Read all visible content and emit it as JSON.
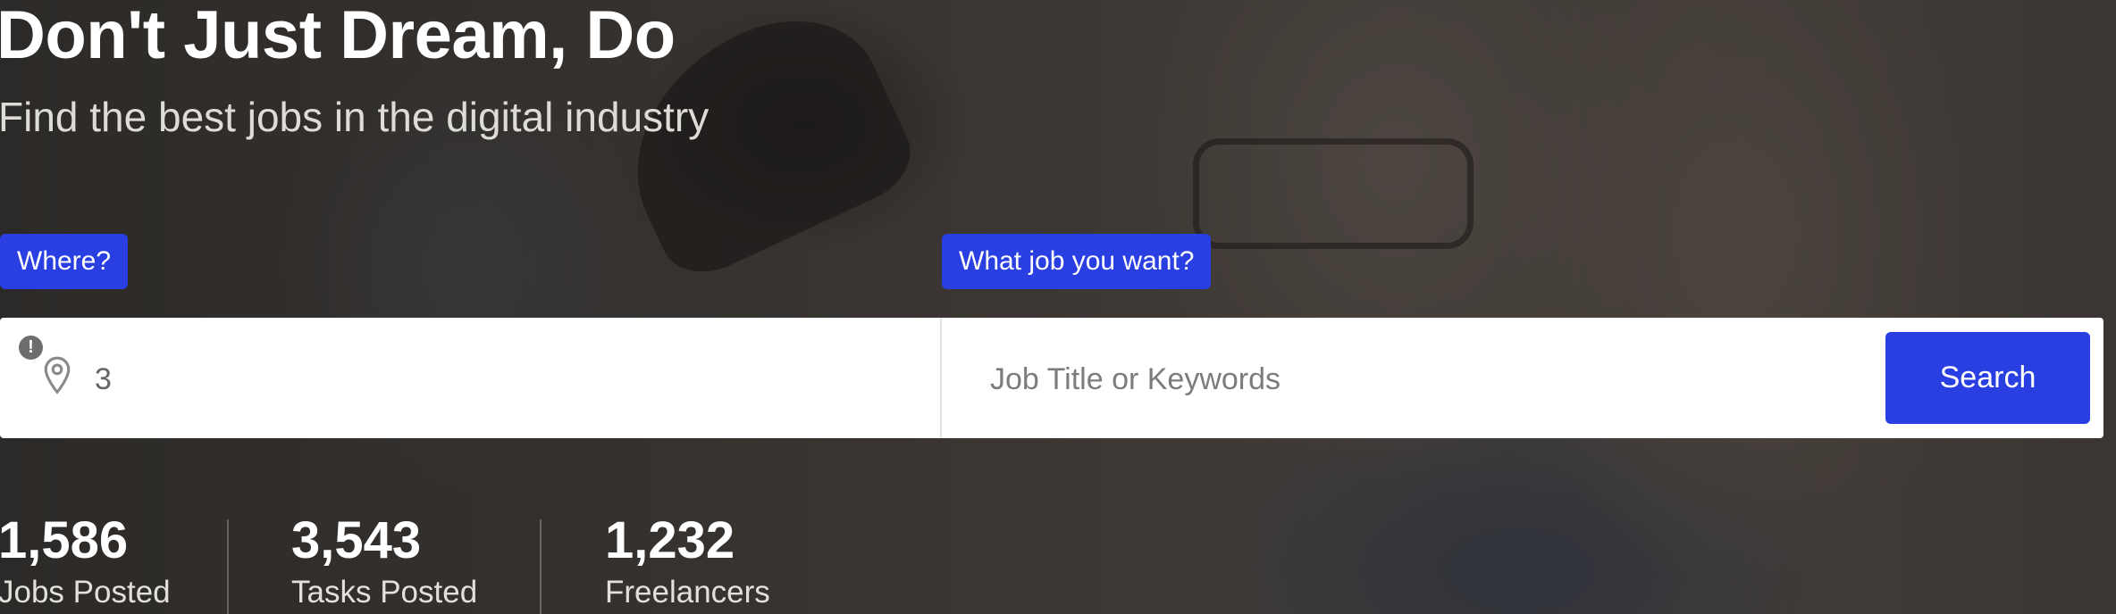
{
  "hero": {
    "title": "Don't Just Dream, Do",
    "subtitle": "Find the best jobs in the digital industry"
  },
  "search": {
    "where_label": "Where?",
    "what_label": "What job you want?",
    "location_value": "3",
    "keyword_placeholder": "Job Title or Keywords",
    "button_label": "Search",
    "alert_glyph": "!",
    "icons": {
      "location": "map-pin-icon",
      "alert": "alert-icon"
    }
  },
  "stats": [
    {
      "value": "1,586",
      "label": "Jobs Posted"
    },
    {
      "value": "3,543",
      "label": "Tasks Posted"
    },
    {
      "value": "1,232",
      "label": "Freelancers"
    }
  ],
  "colors": {
    "accent": "#2a3fe1",
    "text_light": "#ffffff",
    "subtitle": "#dedcd9",
    "search_bg": "#ffffff"
  }
}
